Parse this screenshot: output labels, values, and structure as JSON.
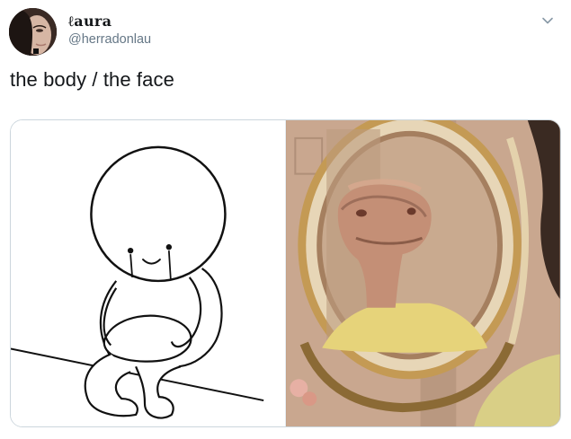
{
  "tweet": {
    "display_name": "ℓaura",
    "handle": "@herradonlau",
    "text": "the body / the face"
  },
  "icons": {
    "avatar": "profile-photo",
    "more": "chevron-down-icon"
  },
  "colors": {
    "text_primary": "#14171a",
    "text_secondary": "#657786",
    "border": "#ccd6dd",
    "caret": "#8899a6"
  }
}
